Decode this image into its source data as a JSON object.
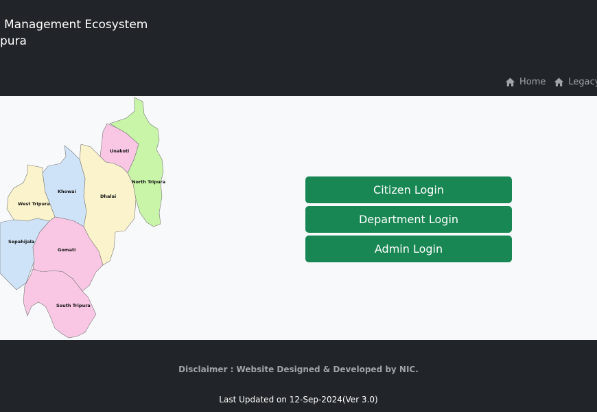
{
  "header": {
    "title_line1": " Management Ecosystem",
    "title_line2": "pura"
  },
  "nav": {
    "items": [
      {
        "label": "Home",
        "icon": "home-icon"
      },
      {
        "label": "Legacy D",
        "icon": "home-icon"
      }
    ]
  },
  "map": {
    "districts": [
      "Unakoti",
      "North Tripura",
      "Khowai",
      "Dhalai",
      "West Tripura",
      "Sepahijala",
      "Gomati",
      "South Tripura"
    ],
    "colors": {
      "north": "#c9f5a9",
      "unakoti": "#f9c7e4",
      "dhalai": "#fbf3cc",
      "khowai": "#cfe3f8",
      "west": "#fbf3cc",
      "sepahijala": "#cfe3f8",
      "gomati": "#f9c7e4",
      "south": "#f9c7e4"
    }
  },
  "login": {
    "citizen": "Citizen Login",
    "department": "Department Login",
    "admin": "Admin Login",
    "accent_color": "#198754"
  },
  "footer": {
    "disclaimer": "Disclaimer : Website Designed & Developed by NIC.",
    "last_updated": "Last Updated on 12-Sep-2024(Ver 3.0)"
  }
}
